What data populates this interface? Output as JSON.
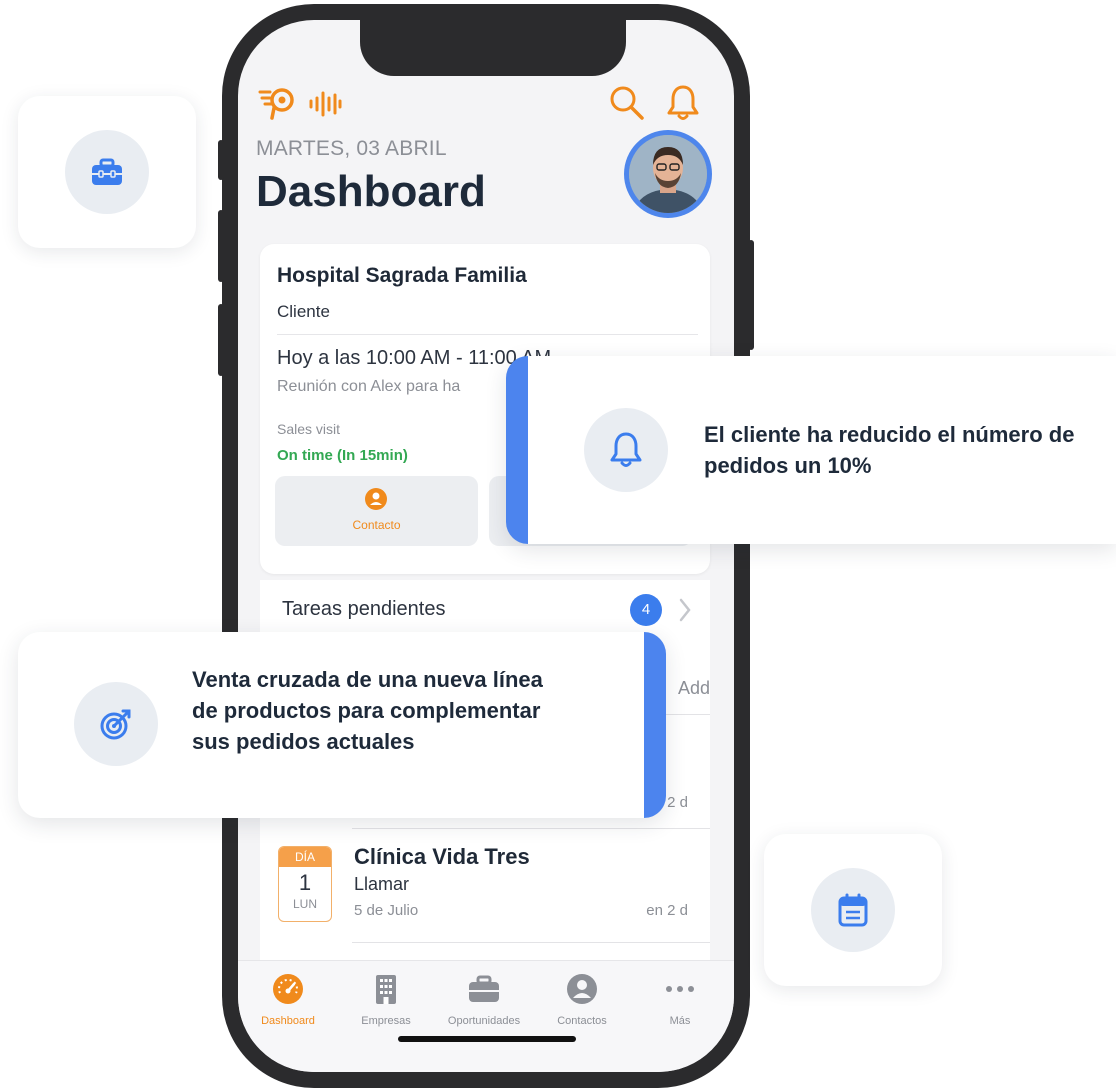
{
  "header": {
    "date": "MARTES, 03 ABRIL",
    "title": "Dashboard"
  },
  "icons": {
    "logo": "logo-icon",
    "voice": "voice-wave-icon",
    "search": "search-icon",
    "notifications": "bell-icon"
  },
  "appointment": {
    "company": "Hospital Sagrada Familia",
    "type": "Cliente",
    "when": "Hoy a las 10:00 AM - 11:00 AM",
    "description": "Reunión con Alex para ha",
    "visit_type": "Sales visit",
    "status": "On time (In 15min)",
    "action_contact": "Contacto"
  },
  "tasks": {
    "label": "Tareas pendientes",
    "count": "4"
  },
  "list": {
    "add_label": "Add",
    "row1_relative": "2 d",
    "event": {
      "cal_header": "DÍA",
      "cal_number": "1",
      "cal_day": "LUN",
      "name": "Clínica Vida Tres",
      "action": "Llamar",
      "date": "5 de Julio",
      "relative": "en 2 d"
    }
  },
  "tabbar": [
    {
      "label": "Dashboard",
      "icon": "gauge-icon",
      "active": true
    },
    {
      "label": "Empresas",
      "icon": "building-icon",
      "active": false
    },
    {
      "label": "Oportunidades",
      "icon": "briefcase-icon",
      "active": false
    },
    {
      "label": "Contactos",
      "icon": "person-icon",
      "active": false
    },
    {
      "label": "Más",
      "icon": "more-dots-icon",
      "active": false
    }
  ],
  "floating": {
    "alert_message": "El cliente ha reducido el número de pedidos un 10%",
    "opportunity_message": "Venta cruzada de una nueva línea de productos para complementar sus pedidos actuales",
    "tile_icons": [
      "briefcase-icon",
      "calendar-icon"
    ]
  },
  "colors": {
    "accent": "#F08A1C",
    "primary_blue": "#3B7DED",
    "success": "#33A853",
    "title_dark": "#1E2A3A"
  }
}
